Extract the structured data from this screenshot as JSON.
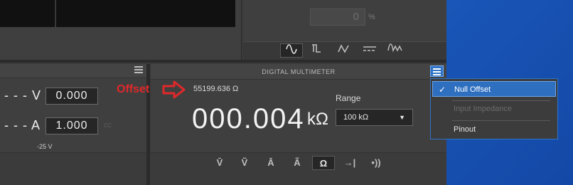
{
  "top_right": {
    "percent_value": "0",
    "percent_unit": "%",
    "wave_buttons": [
      "∿",
      "⎍",
      "∿",
      "═",
      "ʌw"
    ]
  },
  "left_panel": {
    "voltage_dash": "- - - V -",
    "voltage_value": "0.000",
    "current_dash": "- - - A",
    "current_value": "1.000",
    "cc_label": "cc",
    "voltage_limit": "-25 V"
  },
  "dmm": {
    "title": "DIGITAL MULTIMETER",
    "offset_value": "55199.636 Ω",
    "reading": "000.004",
    "reading_unit": "kΩ",
    "range_label": "Range",
    "range_value": "100 kΩ",
    "modes": [
      "V̄",
      "Ṽ",
      "Ā",
      "Ã",
      "Ω",
      "→|",
      "•))"
    ]
  },
  "annotation": {
    "text": "Offset"
  },
  "menu": {
    "items": [
      {
        "label": "Null Offset",
        "state": "selected"
      },
      {
        "label": "Input Impedance",
        "state": "disabled"
      },
      {
        "label": "Pinout",
        "state": "normal"
      }
    ]
  },
  "colors": {
    "accent": "#2e6fc0",
    "annotation": "#e0282a",
    "panel": "#3f3f3f"
  }
}
